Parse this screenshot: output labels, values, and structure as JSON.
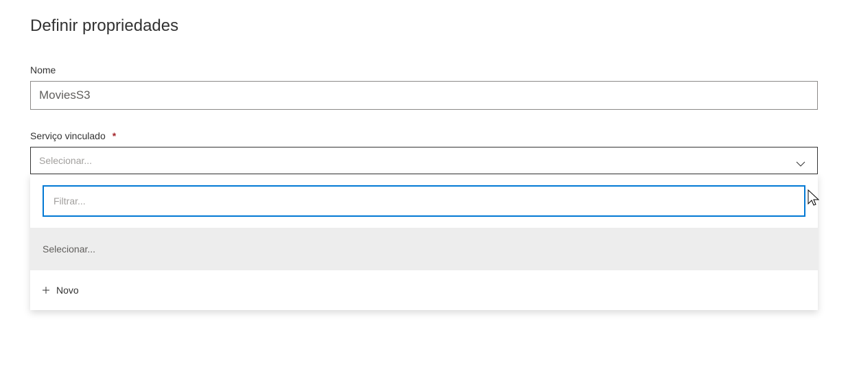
{
  "page": {
    "title": "Definir propriedades"
  },
  "fields": {
    "name": {
      "label": "Nome",
      "value": "MoviesS3"
    },
    "linked_service": {
      "label": "Serviço vinculado",
      "required_mark": "*",
      "placeholder": "Selecionar..."
    }
  },
  "dropdown": {
    "filter_placeholder": "Filtrar...",
    "selected_option": "Selecionar...",
    "new_label": "Novo"
  }
}
